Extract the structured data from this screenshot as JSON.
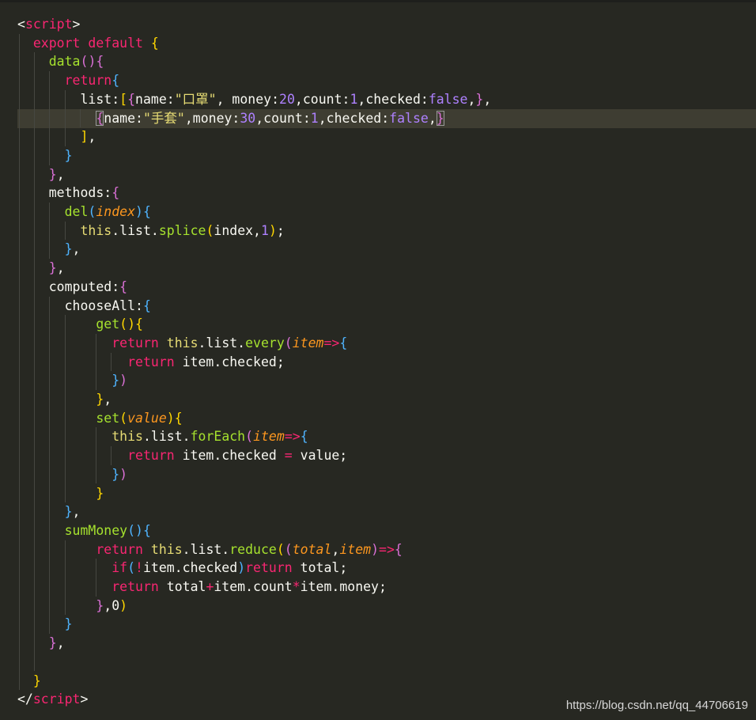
{
  "editor": {
    "lines": [
      [
        {
          "t": "<",
          "c": "c"
        },
        {
          "t": "script",
          "c": "t"
        },
        {
          "t": ">",
          "c": "c"
        }
      ],
      [
        {
          "t": "  "
        },
        {
          "t": "export",
          "c": "k"
        },
        {
          "t": " "
        },
        {
          "t": "default",
          "c": "k"
        },
        {
          "t": " "
        },
        {
          "t": "{",
          "c": "b1"
        }
      ],
      [
        {
          "t": "    "
        },
        {
          "t": "data",
          "c": "f"
        },
        {
          "t": "(",
          "c": "b2"
        },
        {
          "t": ")",
          "c": "b2"
        },
        {
          "t": "{",
          "c": "b2"
        }
      ],
      [
        {
          "t": "      "
        },
        {
          "t": "return",
          "c": "k"
        },
        {
          "t": "{",
          "c": "b3"
        }
      ],
      [
        {
          "t": "        list:"
        },
        {
          "t": "[",
          "c": "b1"
        },
        {
          "t": "{",
          "c": "b2"
        },
        {
          "t": "name:"
        },
        {
          "t": "\"口罩\"",
          "c": "s"
        },
        {
          "t": ", money:"
        },
        {
          "t": "20",
          "c": "n"
        },
        {
          "t": ",count:"
        },
        {
          "t": "1",
          "c": "n"
        },
        {
          "t": ",checked:"
        },
        {
          "t": "false",
          "c": "n"
        },
        {
          "t": ",",
          "c": "c"
        },
        {
          "t": "}",
          "c": "b2"
        },
        {
          "t": ","
        }
      ],
      [
        {
          "t": "          "
        },
        {
          "t": "{",
          "c": "b2 bm"
        },
        {
          "t": "name:"
        },
        {
          "t": "\"手套\"",
          "c": "s"
        },
        {
          "t": ",money:"
        },
        {
          "t": "30",
          "c": "n"
        },
        {
          "t": ",count:"
        },
        {
          "t": "1",
          "c": "n"
        },
        {
          "t": ",checked:"
        },
        {
          "t": "false",
          "c": "n"
        },
        {
          "t": ","
        },
        {
          "t": "}",
          "c": "b2 bm"
        }
      ],
      [
        {
          "t": "        "
        },
        {
          "t": "]",
          "c": "b1"
        },
        {
          "t": ","
        }
      ],
      [
        {
          "t": "      "
        },
        {
          "t": "}",
          "c": "b3"
        }
      ],
      [
        {
          "t": "    "
        },
        {
          "t": "}",
          "c": "b2"
        },
        {
          "t": ","
        }
      ],
      [
        {
          "t": "    methods:"
        },
        {
          "t": "{",
          "c": "b2"
        }
      ],
      [
        {
          "t": "      "
        },
        {
          "t": "del",
          "c": "f"
        },
        {
          "t": "(",
          "c": "b3"
        },
        {
          "t": "index",
          "c": "p"
        },
        {
          "t": ")",
          "c": "b3"
        },
        {
          "t": "{",
          "c": "b3"
        }
      ],
      [
        {
          "t": "        "
        },
        {
          "t": "this",
          "c": "s"
        },
        {
          "t": ".list."
        },
        {
          "t": "splice",
          "c": "f"
        },
        {
          "t": "(",
          "c": "b1"
        },
        {
          "t": "index,"
        },
        {
          "t": "1",
          "c": "n"
        },
        {
          "t": ")",
          "c": "b1"
        },
        {
          "t": ";"
        }
      ],
      [
        {
          "t": "      "
        },
        {
          "t": "}",
          "c": "b3"
        },
        {
          "t": ","
        }
      ],
      [
        {
          "t": "    "
        },
        {
          "t": "}",
          "c": "b2"
        },
        {
          "t": ","
        }
      ],
      [
        {
          "t": "    computed:"
        },
        {
          "t": "{",
          "c": "b2"
        }
      ],
      [
        {
          "t": "      chooseAll:"
        },
        {
          "t": "{",
          "c": "b3"
        }
      ],
      [
        {
          "t": "          "
        },
        {
          "t": "get",
          "c": "f"
        },
        {
          "t": "(",
          "c": "b1"
        },
        {
          "t": ")",
          "c": "b1"
        },
        {
          "t": "{",
          "c": "b1"
        }
      ],
      [
        {
          "t": "            "
        },
        {
          "t": "return",
          "c": "k"
        },
        {
          "t": " "
        },
        {
          "t": "this",
          "c": "s"
        },
        {
          "t": ".list."
        },
        {
          "t": "every",
          "c": "f"
        },
        {
          "t": "(",
          "c": "b2"
        },
        {
          "t": "item",
          "c": "p"
        },
        {
          "t": "=>",
          "c": "o"
        },
        {
          "t": "{",
          "c": "b3"
        }
      ],
      [
        {
          "t": "              "
        },
        {
          "t": "return",
          "c": "k"
        },
        {
          "t": " item.checked;"
        }
      ],
      [
        {
          "t": "            "
        },
        {
          "t": "}",
          "c": "b3"
        },
        {
          "t": ")",
          "c": "b2"
        }
      ],
      [
        {
          "t": "          "
        },
        {
          "t": "}",
          "c": "b1"
        },
        {
          "t": ","
        }
      ],
      [
        {
          "t": "          "
        },
        {
          "t": "set",
          "c": "f"
        },
        {
          "t": "(",
          "c": "b1"
        },
        {
          "t": "value",
          "c": "p"
        },
        {
          "t": ")",
          "c": "b1"
        },
        {
          "t": "{",
          "c": "b1"
        }
      ],
      [
        {
          "t": "            "
        },
        {
          "t": "this",
          "c": "s"
        },
        {
          "t": ".list."
        },
        {
          "t": "forEach",
          "c": "f"
        },
        {
          "t": "(",
          "c": "b2"
        },
        {
          "t": "item",
          "c": "p"
        },
        {
          "t": "=>",
          "c": "o"
        },
        {
          "t": "{",
          "c": "b3"
        }
      ],
      [
        {
          "t": "              "
        },
        {
          "t": "return",
          "c": "k"
        },
        {
          "t": " item.checked "
        },
        {
          "t": "=",
          "c": "o"
        },
        {
          "t": " value;"
        }
      ],
      [
        {
          "t": "            "
        },
        {
          "t": "}",
          "c": "b3"
        },
        {
          "t": ")",
          "c": "b2"
        }
      ],
      [
        {
          "t": "          "
        },
        {
          "t": "}",
          "c": "b1"
        }
      ],
      [
        {
          "t": "      "
        },
        {
          "t": "}",
          "c": "b3"
        },
        {
          "t": ","
        }
      ],
      [
        {
          "t": "      "
        },
        {
          "t": "sumMoney",
          "c": "f"
        },
        {
          "t": "(",
          "c": "b3"
        },
        {
          "t": ")",
          "c": "b3"
        },
        {
          "t": "{",
          "c": "b3"
        }
      ],
      [
        {
          "t": "          "
        },
        {
          "t": "return",
          "c": "k"
        },
        {
          "t": " "
        },
        {
          "t": "this",
          "c": "s"
        },
        {
          "t": ".list."
        },
        {
          "t": "reduce",
          "c": "f"
        },
        {
          "t": "(",
          "c": "b1"
        },
        {
          "t": "(",
          "c": "b2"
        },
        {
          "t": "total",
          "c": "p"
        },
        {
          "t": ","
        },
        {
          "t": "item",
          "c": "p"
        },
        {
          "t": ")",
          "c": "b2"
        },
        {
          "t": "=>",
          "c": "o"
        },
        {
          "t": "{",
          "c": "b2"
        }
      ],
      [
        {
          "t": "            "
        },
        {
          "t": "if",
          "c": "k"
        },
        {
          "t": "(",
          "c": "b3"
        },
        {
          "t": "!",
          "c": "o"
        },
        {
          "t": "item.checked"
        },
        {
          "t": ")",
          "c": "b3"
        },
        {
          "t": "return",
          "c": "k"
        },
        {
          "t": " total;"
        }
      ],
      [
        {
          "t": "            "
        },
        {
          "t": "return",
          "c": "k"
        },
        {
          "t": " total"
        },
        {
          "t": "+",
          "c": "o"
        },
        {
          "t": "item.count"
        },
        {
          "t": "*",
          "c": "o"
        },
        {
          "t": "item.money;"
        }
      ],
      [
        {
          "t": "          "
        },
        {
          "t": "}",
          "c": "b2"
        },
        {
          "t": ",0"
        },
        {
          "t": ")",
          "c": "b1"
        }
      ],
      [
        {
          "t": "      "
        },
        {
          "t": "}",
          "c": "b3"
        }
      ],
      [
        {
          "t": "    "
        },
        {
          "t": "}",
          "c": "b2"
        },
        {
          "t": ","
        }
      ],
      [],
      [
        {
          "t": "  "
        },
        {
          "t": "}",
          "c": "b1"
        }
      ],
      [
        {
          "t": "</",
          "c": "c"
        },
        {
          "t": "script",
          "c": "t"
        },
        {
          "t": ">",
          "c": "c"
        }
      ]
    ]
  },
  "watermark": "https://blog.csdn.net/qq_44706619"
}
